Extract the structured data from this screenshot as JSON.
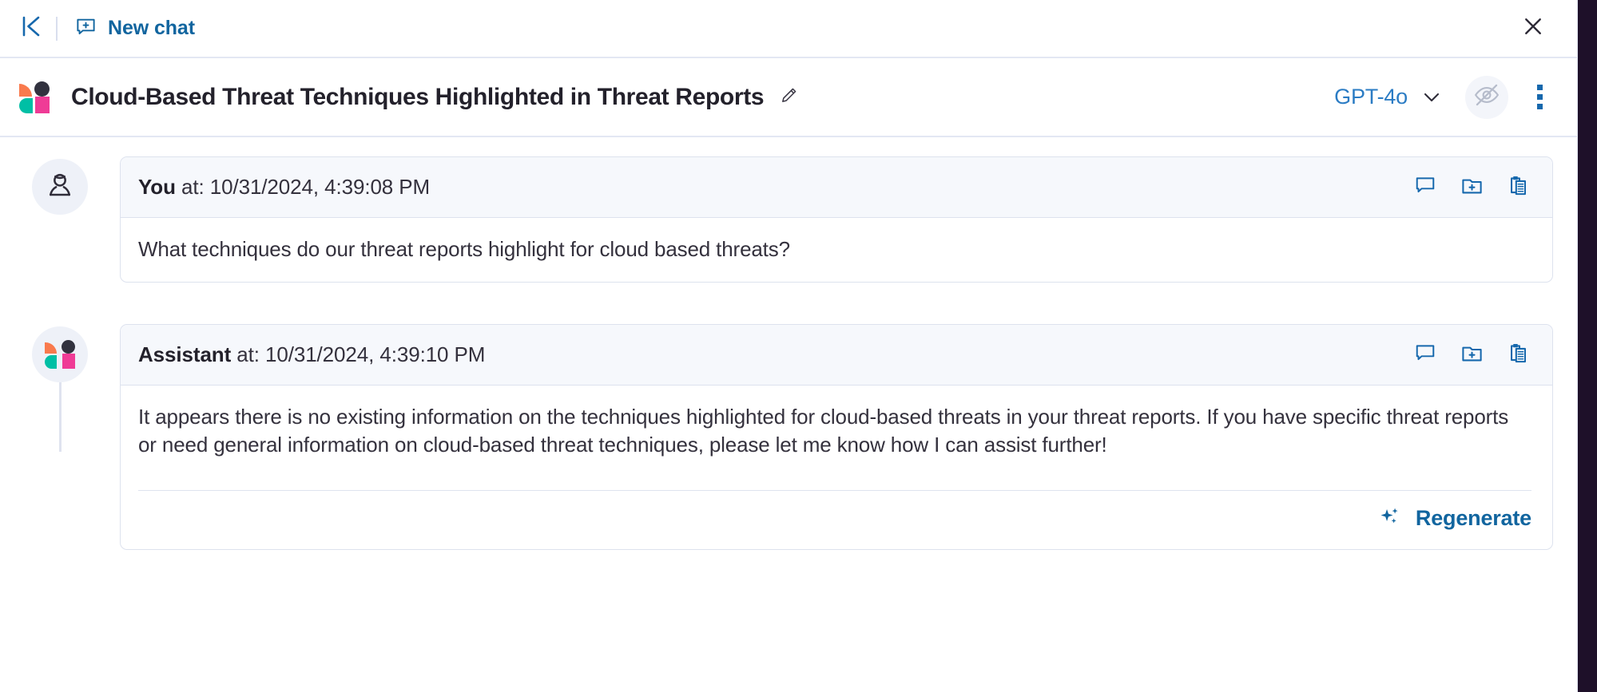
{
  "topbar": {
    "collapse_icon": "collapse-panel-icon",
    "new_chat_label": "New chat",
    "new_chat_icon": "new-chat-bubble-plus-icon",
    "close_icon": "close-icon"
  },
  "title_row": {
    "brand_logo": "brand-logo-mark",
    "title": "Cloud-Based Threat Techniques Highlighted in Threat Reports",
    "edit_icon": "pencil-edit-icon",
    "model": "GPT-4o",
    "model_caret_icon": "chevron-down-icon",
    "visibility_icon": "eye-off-icon",
    "overflow_icon": "kebab-menu-icon"
  },
  "messages": [
    {
      "avatar": "user-avatar",
      "role": "You",
      "timestamp": " at: 10/31/2024, 4:39:08 PM",
      "body": "What techniques do our threat reports highlight for cloud based threats?",
      "actions": [
        "comment-icon",
        "add-to-folder-icon",
        "copy-clipboard-icon"
      ],
      "has_footer": false
    },
    {
      "avatar": "assistant-avatar",
      "role": "Assistant",
      "timestamp": " at: 10/31/2024, 4:39:10 PM",
      "body": "It appears there is no existing information on the techniques highlighted for cloud-based threats in your threat reports. If you have specific threat reports or need general information on cloud-based threat techniques, please let me know how I can assist further!",
      "actions": [
        "comment-icon",
        "add-to-folder-icon",
        "copy-clipboard-icon"
      ],
      "has_footer": true,
      "footer": {
        "regenerate_label": "Regenerate",
        "regenerate_icon": "sparkles-icon"
      }
    }
  ],
  "colors": {
    "accent_blue": "#1668ad",
    "link_blue": "#11659f",
    "model_blue": "#2b7cc4",
    "brand_orange": "#f97a4d",
    "brand_teal": "#00bfa5",
    "brand_pink": "#ef3b96",
    "brand_dark": "#32323f",
    "card_border": "#dde2ee",
    "card_head_bg": "#f6f8fc",
    "text_primary": "#34313d",
    "edge_strip": "#1e1029"
  }
}
